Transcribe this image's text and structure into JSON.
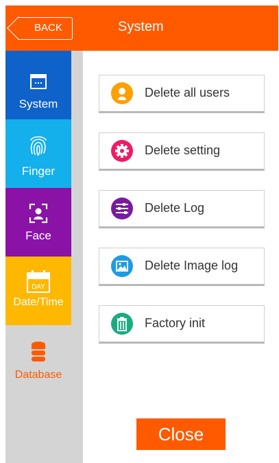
{
  "header": {
    "back_label": "BACK",
    "title": "System"
  },
  "sidebar": {
    "items": [
      {
        "label": "System",
        "icon": "window-icon",
        "color": "#0f62c9"
      },
      {
        "label": "Finger",
        "icon": "fingerprint-icon",
        "color": "#14b0ec"
      },
      {
        "label": "Face",
        "icon": "face-scan-icon",
        "color": "#8a12a6"
      },
      {
        "label": "Date/Time",
        "icon": "calendar-icon",
        "color": "#ffb800",
        "icon_text": "DAY"
      },
      {
        "label": "Database",
        "icon": "database-icon",
        "color": "#ff5a00",
        "active": true
      }
    ]
  },
  "actions": [
    {
      "label": "Delete all users",
      "icon": "user-icon",
      "color": "#ffa000"
    },
    {
      "label": "Delete setting",
      "icon": "gear-icon",
      "color": "#ee1c66"
    },
    {
      "label": "Delete Log",
      "icon": "sliders-icon",
      "color": "#7a1aa0"
    },
    {
      "label": "Delete Image log",
      "icon": "image-icon",
      "color": "#1e9be4"
    },
    {
      "label": "Factory init",
      "icon": "trash-icon",
      "color": "#1aab80"
    }
  ],
  "footer": {
    "close_label": "Close"
  },
  "colors": {
    "accent": "#ff5a00"
  }
}
